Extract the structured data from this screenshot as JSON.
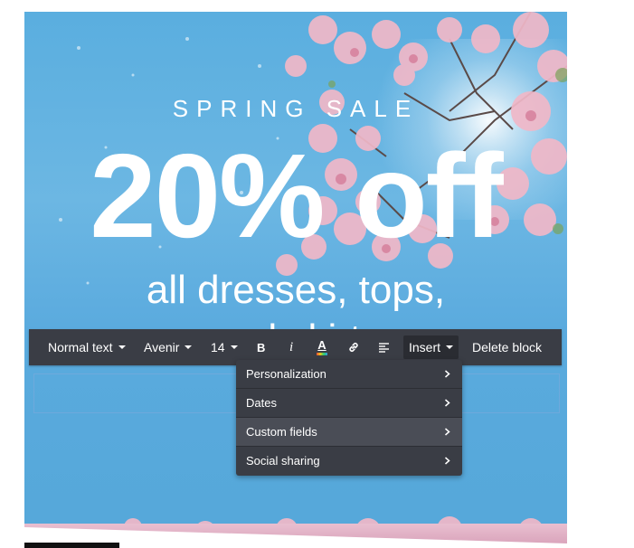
{
  "hero": {
    "eyebrow": "SPRING SALE",
    "headline": "20% off",
    "subline": "all dresses, tops,",
    "subline2": "and skirts"
  },
  "toolbar": {
    "text_style": "Normal text",
    "font": "Avenir",
    "size": "14",
    "bold_label": "B",
    "italic_label": "i",
    "color_label": "A",
    "insert_label": "Insert",
    "delete_label": "Delete block",
    "icons": [
      "bold-icon",
      "italic-icon",
      "text-color-icon",
      "link-icon",
      "align-icon"
    ]
  },
  "insert_menu": {
    "items": [
      {
        "label": "Personalization"
      },
      {
        "label": "Dates"
      },
      {
        "label": "Custom fields"
      },
      {
        "label": "Social sharing"
      }
    ],
    "highlighted": "Custom fields"
  }
}
